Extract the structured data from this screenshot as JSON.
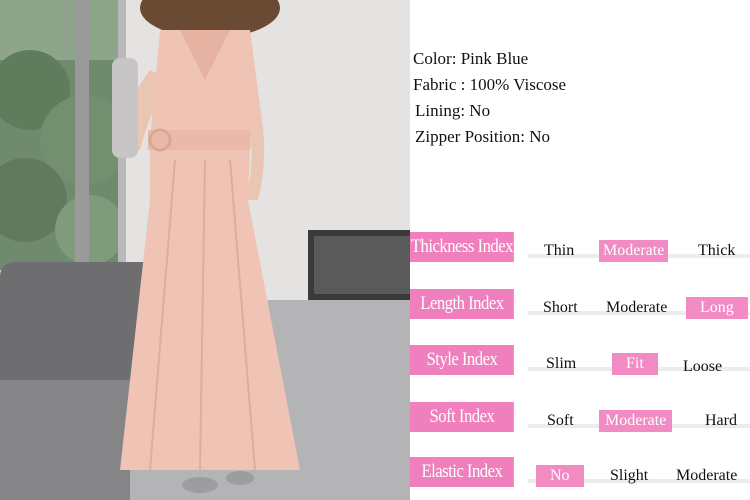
{
  "product": {
    "specs": [
      "Color: Pink   Blue",
      "Fabric : 100% Viscose",
      "Lining: No",
      "Zipper Position: No"
    ]
  },
  "colors": {
    "accent_pink": "#f07fbd",
    "dress_pink": "#f0c4b4"
  },
  "indices": [
    {
      "label": "Thickness Index",
      "options": [
        "Thin",
        "Moderate",
        "Thick"
      ],
      "selected": "Moderate"
    },
    {
      "label": "Length Index",
      "options": [
        "Short",
        "Moderate",
        "Long"
      ],
      "selected": "Long"
    },
    {
      "label": "Style Index",
      "options": [
        "Slim",
        "Fit",
        "Loose"
      ],
      "selected": "Fit"
    },
    {
      "label": "Soft Index",
      "options": [
        "Soft",
        "Moderate",
        "Hard"
      ],
      "selected": "Moderate"
    },
    {
      "label": "Elastic Index",
      "options": [
        "No",
        "Slight",
        "Moderate"
      ],
      "selected": "No"
    }
  ]
}
